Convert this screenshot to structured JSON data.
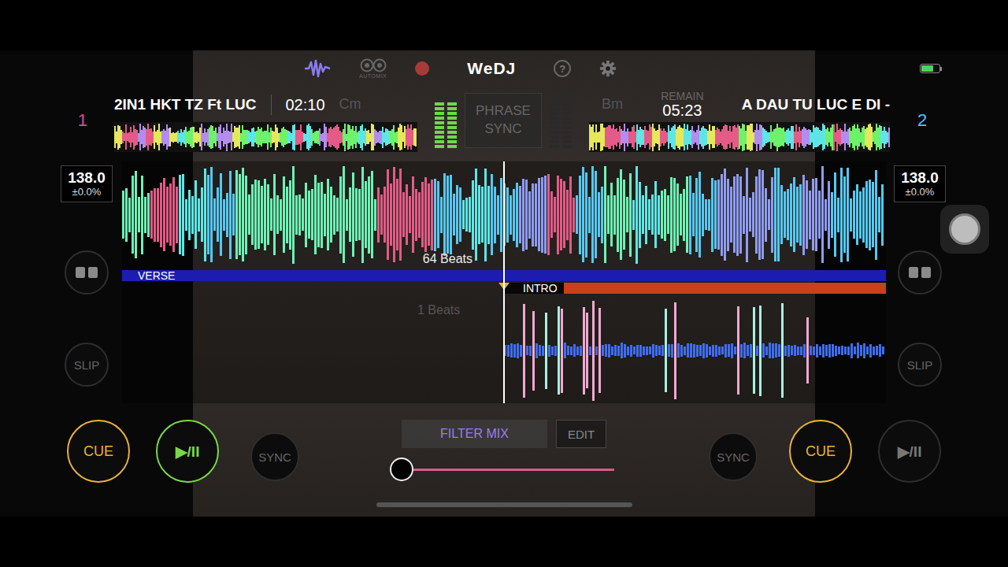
{
  "app": {
    "title": "WeDJ"
  },
  "toolbar": {
    "automix_label": "AUTOMIX",
    "help": "?",
    "battery": {
      "level": 0.7
    }
  },
  "phrase_sync": {
    "label": "PHRASE SYNC",
    "on": false
  },
  "decks": [
    {
      "number": "1",
      "color": "#e8458b",
      "title": "2IN1 HKT TZ Ft LUC",
      "time_label": "",
      "time": "02:10",
      "key": "Cm",
      "bpm": "138.0",
      "pitch": "±0.0%",
      "playing": true,
      "meters": [
        0.8,
        0.8
      ],
      "beats": "64 Beats",
      "phrase": {
        "label": "VERSE",
        "color": "#1c1cb0"
      },
      "cue_label": "CUE",
      "play_label": "▶/II",
      "sync_label": "SYNC",
      "slip_label": "SLIP"
    },
    {
      "number": "2",
      "color": "#4fc3f7",
      "title": "A DAU TU LUC E DI -",
      "time_label": "REMAIN",
      "time": "05:23",
      "key": "Bm",
      "bpm": "138.0",
      "pitch": "±0.0%",
      "playing": false,
      "meters": [
        0,
        0
      ],
      "beats": "1 Beats",
      "phrase": {
        "label": "INTRO",
        "color": "#c8401c"
      },
      "cue_label": "CUE",
      "play_label": "▶/II",
      "sync_label": "SYNC",
      "slip_label": "SLIP"
    }
  ],
  "mixer": {
    "mode": "FILTER MIX",
    "edit": "EDIT",
    "crossfader": {
      "level": 0
    }
  }
}
